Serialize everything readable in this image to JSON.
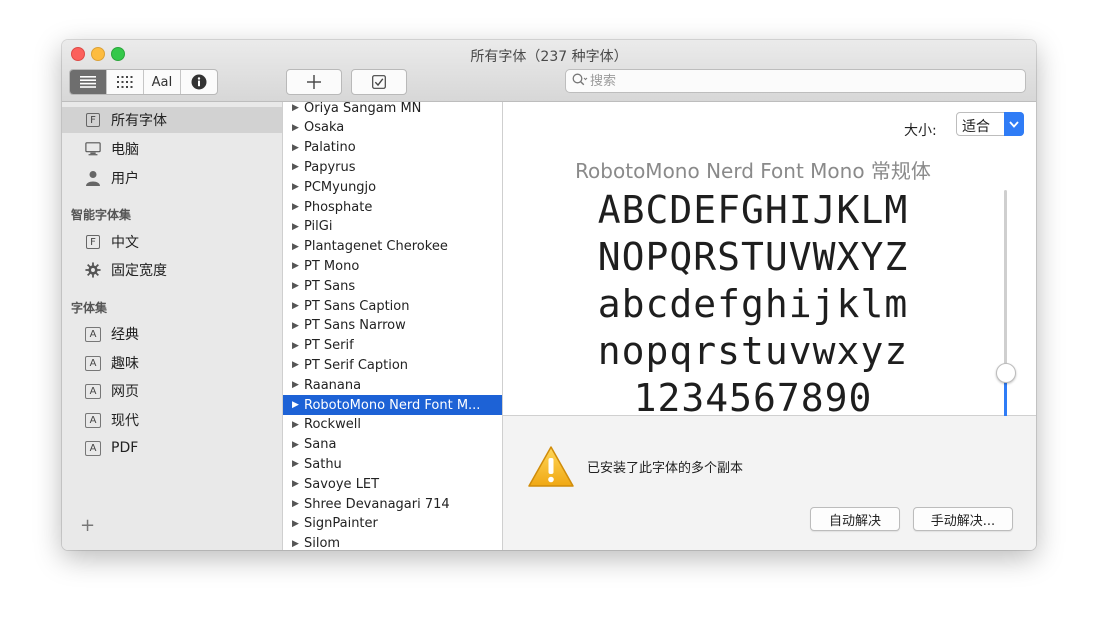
{
  "window": {
    "title": "所有字体（237 种字体）"
  },
  "toolbar": {
    "text_sample_label": "AaI",
    "search_placeholder": "搜索"
  },
  "sidebar": {
    "library_items": [
      {
        "label": "所有字体"
      },
      {
        "label": "电脑"
      },
      {
        "label": "用户"
      }
    ],
    "smart_header": "智能字体集",
    "smart_items": [
      {
        "label": "中文"
      },
      {
        "label": "固定宽度"
      }
    ],
    "collections_header": "字体集",
    "collection_items": [
      {
        "label": "经典"
      },
      {
        "label": "趣味"
      },
      {
        "label": "网页"
      },
      {
        "label": "现代"
      },
      {
        "label": "PDF"
      }
    ],
    "add_label": "+"
  },
  "font_list": [
    "Oriya Sangam MN",
    "Osaka",
    "Palatino",
    "Papyrus",
    "PCMyungjo",
    "Phosphate",
    "PilGi",
    "Plantagenet Cherokee",
    "PT Mono",
    "PT Sans",
    "PT Sans Caption",
    "PT Sans Narrow",
    "PT Serif",
    "PT Serif Caption",
    "Raanana",
    "RobotoMono Nerd Font M...",
    "Rockwell",
    "Sana",
    "Sathu",
    "Savoye LET",
    "Shree Devanagari 714",
    "SignPainter",
    "Silom"
  ],
  "selected_font_index": 15,
  "preview": {
    "size_label": "大小:",
    "size_value": "适合",
    "font_name": "RobotoMono Nerd Font Mono 常规体",
    "lines": [
      "ABCDEFGHIJKLM",
      "NOPQRSTUVWXYZ",
      "abcdefghijklm",
      "nopqrstuvwxyz",
      "1234567890"
    ],
    "slider_fraction": 0.26
  },
  "info": {
    "message": "已安装了此字体的多个副本",
    "auto_resolve": "自动解决",
    "manual_resolve": "手动解决..."
  },
  "colors": {
    "selection": "#1d62d6",
    "accent": "#2f7cf6"
  }
}
